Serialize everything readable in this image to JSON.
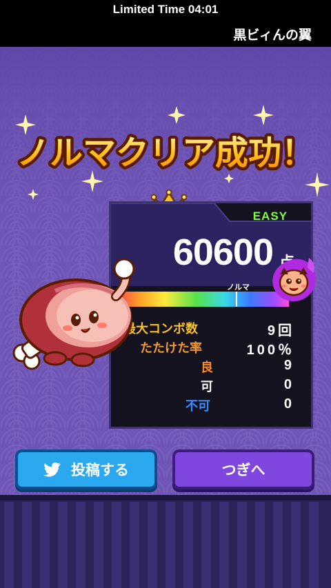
{
  "status": {
    "timer": "Limited Time 04:01",
    "song_title": "黒ビィんの翼"
  },
  "result": {
    "banner": "ノルマクリア成功！",
    "difficulty": "EASY",
    "score": "60600",
    "score_unit": "点",
    "norma_label": "ノルマ",
    "gauge_level": 1.0,
    "stats": [
      {
        "label": "最大コンボ数",
        "value": "9回",
        "color": "#f5c12e"
      },
      {
        "label": "たたけた率",
        "value": "100％",
        "color": "#f29a2e"
      },
      {
        "label": "良",
        "value": "9",
        "color": "#ff8a1e"
      },
      {
        "label": "可",
        "value": "0",
        "color": "#ffffff"
      },
      {
        "label": "不可",
        "value": "0",
        "color": "#3b8cff"
      }
    ]
  },
  "buttons": {
    "post": "投稿する",
    "next": "つぎへ"
  },
  "colors": {
    "background": "#6f55b5",
    "panel": "#15121f",
    "post_button": "#2aa8f0",
    "next_button": "#7f47e0",
    "difficulty": "#7dff3a"
  }
}
